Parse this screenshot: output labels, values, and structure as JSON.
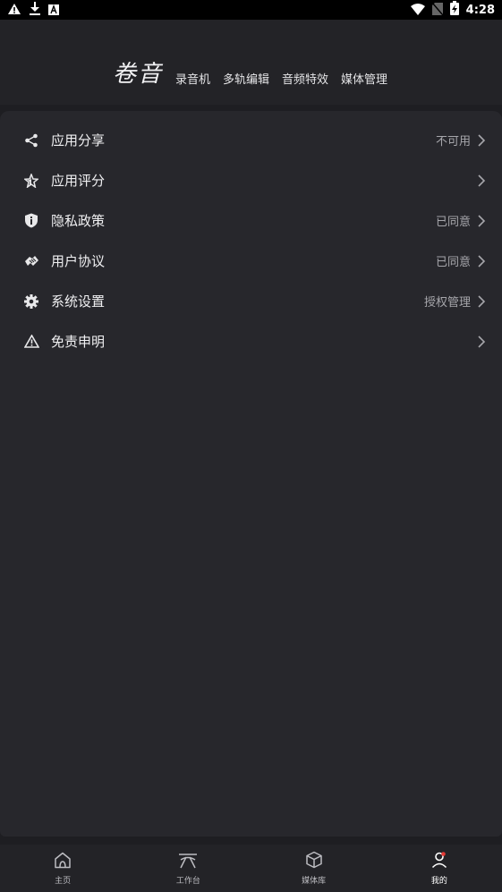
{
  "status_bar": {
    "time": "4:28",
    "left_icons": [
      "warning-icon",
      "download-icon",
      "app-notification-icon"
    ],
    "right_icons": [
      "wifi-icon",
      "no-sim-icon",
      "battery-charging-icon"
    ]
  },
  "header": {
    "brand": "卷音",
    "tags": [
      "录音机",
      "多轨编辑",
      "音频特效",
      "媒体管理"
    ]
  },
  "menu": [
    {
      "icon": "share-icon",
      "label": "应用分享",
      "value": "不可用"
    },
    {
      "icon": "star-rate-icon",
      "label": "应用评分",
      "value": ""
    },
    {
      "icon": "shield-info-icon",
      "label": "隐私政策",
      "value": "已同意"
    },
    {
      "icon": "handshake-icon",
      "label": "用户协议",
      "value": "已同意"
    },
    {
      "icon": "gear-icon",
      "label": "系统设置",
      "value": "授权管理"
    },
    {
      "icon": "warning-triangle-icon",
      "label": "免责申明",
      "value": ""
    }
  ],
  "bottom_nav": [
    {
      "icon": "home-icon",
      "label": "主页"
    },
    {
      "icon": "workbench-icon",
      "label": "工作台"
    },
    {
      "icon": "cube-icon",
      "label": "媒体库"
    },
    {
      "icon": "user-icon",
      "label": "我的",
      "active": true
    }
  ],
  "colors": {
    "background": "#1e1e22",
    "panel": "#27272c",
    "text": "#f0f0f2",
    "secondary_text": "#a6a6ab",
    "notification_dot": "#e53935"
  }
}
